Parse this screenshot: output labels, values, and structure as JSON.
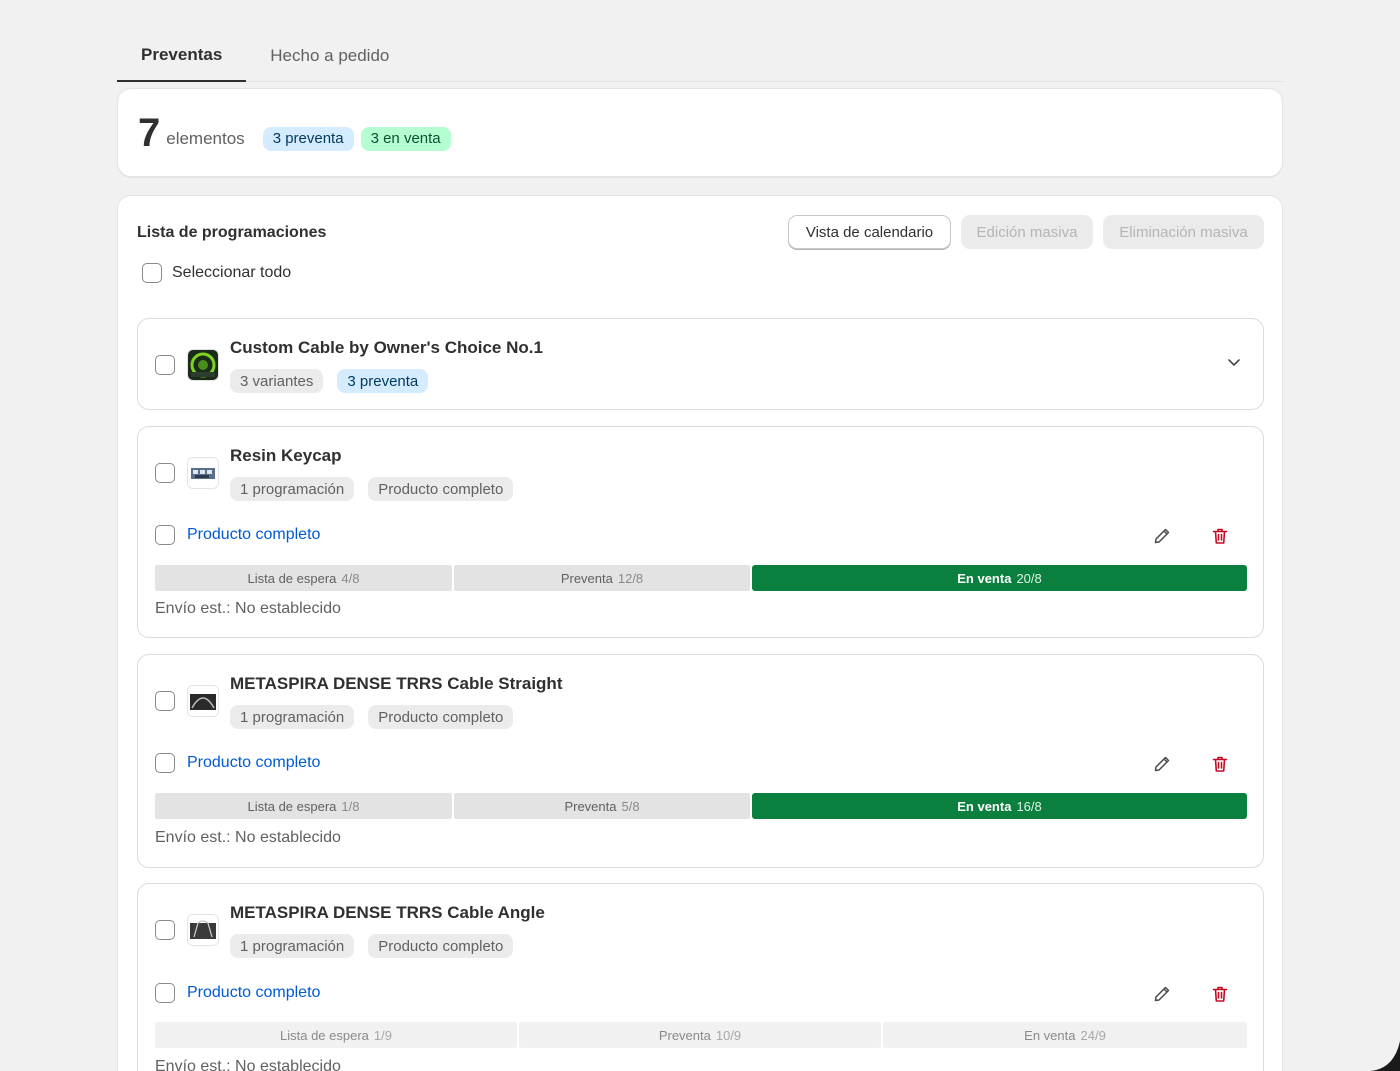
{
  "tabs": [
    {
      "label": "Preventas",
      "active": true
    },
    {
      "label": "Hecho a pedido",
      "active": false
    }
  ],
  "summary": {
    "count": "7",
    "count_label": "elementos",
    "badge_preorder": "3 preventa",
    "badge_onsale": "3 en venta"
  },
  "list": {
    "title": "Lista de programaciones",
    "calendar_button": "Vista de calendario",
    "bulk_edit_button": "Edición masiva",
    "bulk_delete_button": "Eliminación masiva",
    "select_all": "Seleccionar todo"
  },
  "items": [
    {
      "title": "Custom Cable by Owner's Choice No.1",
      "badges": [
        "3 variantes",
        "3 preventa"
      ]
    },
    {
      "title": "Resin Keycap",
      "badges": [
        "1 programación",
        "Producto completo"
      ],
      "link": "Producto completo",
      "timeline": [
        {
          "label": "Lista de espera",
          "date": "4/8"
        },
        {
          "label": "Preventa",
          "date": "12/8"
        },
        {
          "label": "En venta",
          "date": "20/8"
        }
      ],
      "shipping": "Envío est.: No establecido"
    },
    {
      "title": "METASPIRA DENSE TRRS Cable Straight",
      "badges": [
        "1 programación",
        "Producto completo"
      ],
      "link": "Producto completo",
      "timeline": [
        {
          "label": "Lista de espera",
          "date": "1/8"
        },
        {
          "label": "Preventa",
          "date": "5/8"
        },
        {
          "label": "En venta",
          "date": "16/8"
        }
      ],
      "shipping": "Envío est.: No establecido"
    },
    {
      "title": "METASPIRA DENSE TRRS Cable Angle",
      "badges": [
        "1 programación",
        "Producto completo"
      ],
      "link": "Producto completo",
      "timeline": [
        {
          "label": "Lista de espera",
          "date": "1/9"
        },
        {
          "label": "Preventa",
          "date": "10/9"
        },
        {
          "label": "En venta",
          "date": "24/9"
        }
      ],
      "shipping": "Envío est.: No establecido"
    }
  ],
  "colors": {
    "link": "#005bd3",
    "onsale_active": "#0b7f3e",
    "delete_icon": "#c70a24",
    "badge_blue": "#d5ebff",
    "badge_green": "#b4fed2"
  }
}
